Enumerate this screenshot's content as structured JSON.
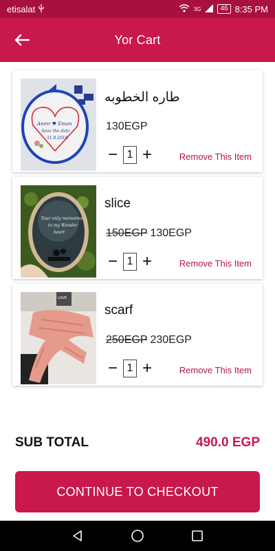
{
  "status_bar": {
    "carrier": "etisalat",
    "battery": "46",
    "time": "8:35 PM",
    "signal_label": "3G"
  },
  "app_bar": {
    "title": "Yor Cart",
    "back_icon": "arrow-left-icon"
  },
  "cart": {
    "items": [
      {
        "name": "طاره الخطوبه",
        "old_price": "",
        "price": "130EGP",
        "quantity": "1",
        "remove_label": "Remove This Item",
        "image": "embroidery-hoop"
      },
      {
        "name": "slice",
        "old_price": "150EGP",
        "price": "130EGP",
        "quantity": "1",
        "remove_label": "Remove This Item",
        "image": "wood-slice"
      },
      {
        "name": "scarf",
        "old_price": "250EGP",
        "price": "230EGP",
        "quantity": "1",
        "remove_label": "Remove This Item",
        "image": "knitted-scarf"
      }
    ]
  },
  "summary": {
    "label": "SUB TOTAL",
    "value": "490.0 EGP"
  },
  "checkout": {
    "label": "CONTINUE TO CHECKOUT"
  },
  "colors": {
    "primary": "#c8184c",
    "status_bar": "#a8103f",
    "accent_text": "#b0163f"
  }
}
